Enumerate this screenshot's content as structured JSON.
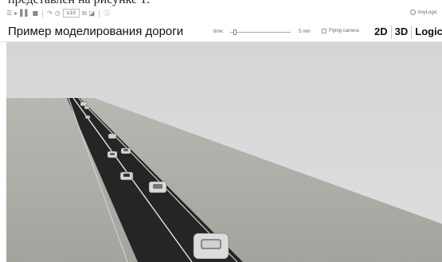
{
  "caption": "представлен на рисунке 1:",
  "toolbar": {
    "speed_value": "x10",
    "brand": "AnyLogic"
  },
  "header": {
    "title": "Пример моделирования дороги",
    "time_label": "time:",
    "time_end_label": "5 min",
    "time_slider_fraction": 0.05,
    "flying_camera_label": "Flying camera",
    "flying_camera_checked": false,
    "view_2d": "2D",
    "view_3d": "3D",
    "view_logic": "Logic"
  },
  "icons": [
    "menu-icon",
    "play-icon",
    "pause-icon",
    "stop-icon",
    "step-icon",
    "clock-icon",
    "camera-icon",
    "layers-icon",
    "info-icon",
    "anylogic-logo-icon"
  ],
  "colors": {
    "sky": "#d9d9d9",
    "ground": "#aaa9a4",
    "road": "#252525",
    "lane_line": "#e0e0e0",
    "car_body": "#d2d2d2"
  }
}
